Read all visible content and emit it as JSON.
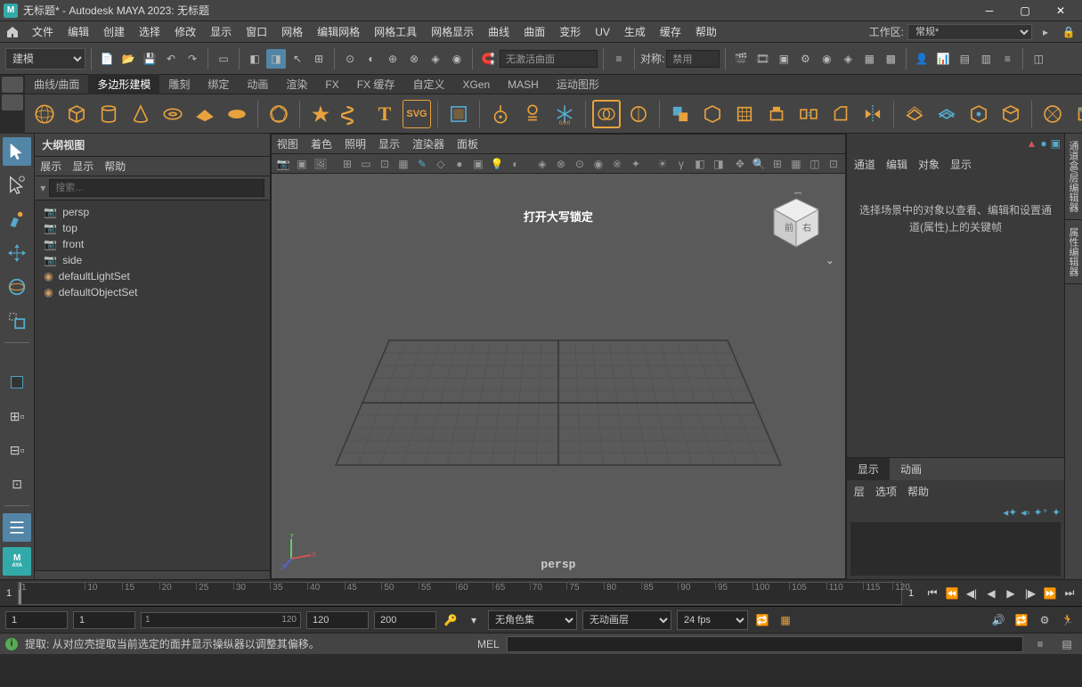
{
  "titlebar": {
    "title": "无标题* - Autodesk MAYA 2023: 无标题",
    "logo": "M"
  },
  "menubar": {
    "items": [
      "文件",
      "编辑",
      "创建",
      "选择",
      "修改",
      "显示",
      "窗口",
      "网格",
      "编辑网格",
      "网格工具",
      "网格显示",
      "曲线",
      "曲面",
      "变形",
      "UV",
      "生成",
      "缓存",
      "帮助"
    ],
    "workspace_label": "工作区:",
    "workspace_value": "常规*"
  },
  "toolbar": {
    "mode": "建模",
    "no_active_surface": "无激活曲面",
    "symmetry_label": "对称:",
    "symmetry_value": "禁用"
  },
  "shelf": {
    "tabs": [
      "曲线/曲面",
      "多边形建模",
      "雕刻",
      "绑定",
      "动画",
      "渲染",
      "FX",
      "FX 缓存",
      "自定义",
      "XGen",
      "MASH",
      "运动图形"
    ],
    "active_tab": 1
  },
  "outliner": {
    "title": "大纲视图",
    "menu": [
      "展示",
      "显示",
      "帮助"
    ],
    "search_placeholder": "搜索...",
    "nodes": [
      {
        "type": "cam",
        "label": "persp"
      },
      {
        "type": "cam",
        "label": "top"
      },
      {
        "type": "cam",
        "label": "front"
      },
      {
        "type": "cam",
        "label": "side"
      },
      {
        "type": "set",
        "label": "defaultLightSet"
      },
      {
        "type": "set",
        "label": "defaultObjectSet"
      }
    ]
  },
  "viewport": {
    "menu": [
      "视图",
      "着色",
      "照明",
      "显示",
      "渲染器",
      "面板"
    ],
    "camera": "persp",
    "overlay": "打开大写锁定"
  },
  "channel": {
    "menu": [
      "通道",
      "编辑",
      "对象",
      "显示"
    ],
    "hint": "选择场景中的对象以查看、编辑和设置通道(属性)上的关键帧",
    "layer_tabs": [
      "显示",
      "动画"
    ],
    "layer_menu": [
      "层",
      "选项",
      "帮助"
    ]
  },
  "sidetabs": [
    "通道盒/层编辑器",
    "属性编辑器"
  ],
  "timeline": {
    "start": "1",
    "end": "200",
    "current": "1",
    "ticks": [
      "1",
      "10",
      "15",
      "20",
      "25",
      "30",
      "35",
      "40",
      "45",
      "50",
      "55",
      "60",
      "65",
      "70",
      "75",
      "80",
      "85",
      "90",
      "95",
      "100",
      "105",
      "110",
      "115",
      "120"
    ],
    "range_start": "1",
    "range_end": "120",
    "end_marker": "1"
  },
  "range": {
    "f1": "1",
    "f2": "1",
    "f3": "1",
    "f3b": "120",
    "f4": "120",
    "f5": "200",
    "color_mode": "无角色集",
    "anim_layer": "无动画层",
    "fps": "24 fps"
  },
  "status": {
    "hint_label": "提取:",
    "hint": "从对应壳提取当前选定的面并显示操纵器以调整其偏移。",
    "mel": "MEL"
  }
}
